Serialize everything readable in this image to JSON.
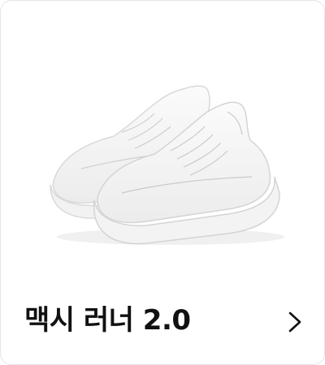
{
  "product": {
    "name": "맥시 러너 2.0"
  },
  "icons": {
    "image": "white-running-shoes-image",
    "arrow": "chevron-right-icon"
  },
  "colors": {
    "background": "#ffffff",
    "text": "#111111"
  }
}
